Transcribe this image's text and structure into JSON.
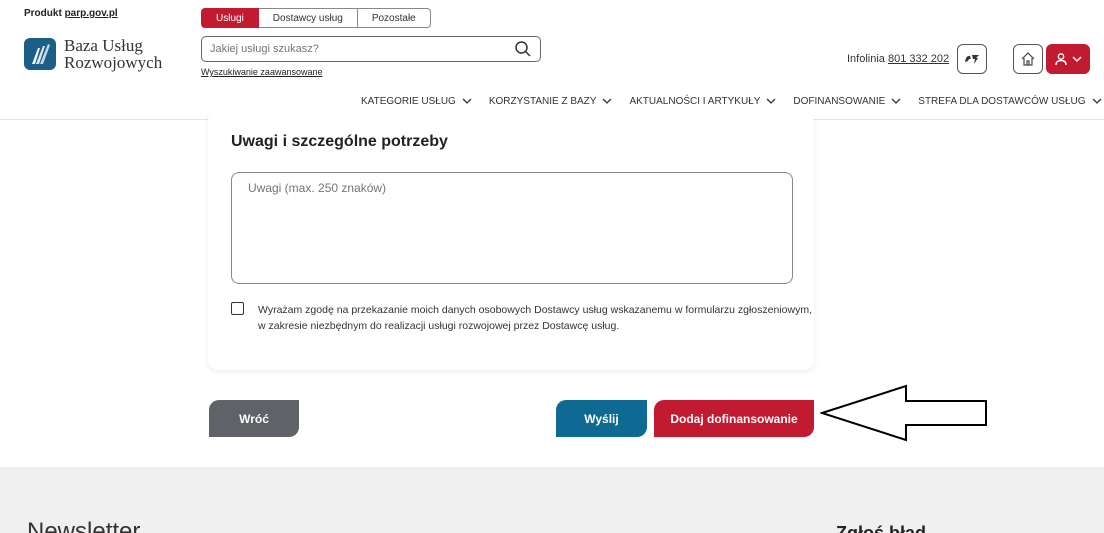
{
  "header": {
    "product_prefix": "Produkt ",
    "product_link": "parp.gov.pl",
    "logo_line1": "Baza Usług",
    "logo_line2": "Rozwojowych",
    "tabs": [
      {
        "label": "Usługi",
        "active": true
      },
      {
        "label": "Dostawcy usług",
        "active": false
      },
      {
        "label": "Pozostałe",
        "active": false
      }
    ],
    "search_placeholder": "Jakiej usługi szukasz?",
    "advanced_search": "Wyszukiwanie zaawansowane",
    "infolinia_label": "Infolinia ",
    "infolinia_number": "801 332 202",
    "nav": [
      {
        "label": "KATEGORIE USŁUG"
      },
      {
        "label": "KORZYSTANIE Z BAZY"
      },
      {
        "label": "AKTUALNOŚCI I ARTYKUŁY"
      },
      {
        "label": "DOFINANSOWANIE"
      },
      {
        "label": "STREFA DLA DOSTAWCÓW USŁUG"
      }
    ]
  },
  "form": {
    "section_title": "Uwagi i szczególne potrzeby",
    "notes_placeholder": "Uwagi (max. 250 znaków)",
    "notes_value": "",
    "consent_checked": false,
    "consent_text": "Wyrażam zgodę na przekazanie moich danych osobowych Dostawcy usług wskazanemu w formularzu zgłoszeniowym, w zakresie niezbędnym do realizacji usługi rozwojowej przez Dostawcę usług."
  },
  "actions": {
    "back": "Wróć",
    "send": "Wyślij",
    "add_funding": "Dodaj dofinansowanie"
  },
  "footer": {
    "newsletter": "Newsletter",
    "report_error": "Zgłoś błąd"
  },
  "colors": {
    "brand_red": "#c21a30",
    "send_blue": "#0f6a93",
    "back_gray": "#5f6368"
  }
}
